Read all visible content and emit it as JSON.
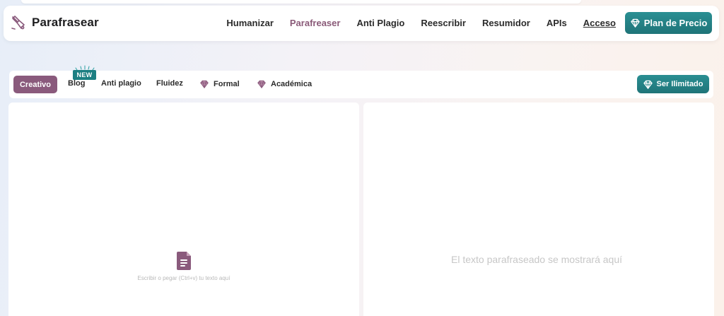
{
  "app": {
    "brand_name": "Parafrasear",
    "brand_icon": "quill-pen-icon"
  },
  "nav": {
    "items": [
      {
        "label": "Humanizar"
      },
      {
        "label": "Parafreaser",
        "active": true
      },
      {
        "label": "Anti Plagio"
      },
      {
        "label": "Reescribir"
      },
      {
        "label": "Resumidor"
      },
      {
        "label": "APIs"
      },
      {
        "label": "Acceso",
        "underline": true
      }
    ],
    "plan_button": "Plan de Precio",
    "plan_icon": "diamond-icon"
  },
  "modes": {
    "creativo": "Creativo",
    "blog": "Blog",
    "new_badge": "NEW",
    "anti_plagio": "Anti plagio",
    "fluidez": "Fluidez",
    "formal": "Formal",
    "academica": "Académica",
    "premium_icon": "diamond-icon",
    "unlimited_button": "Ser Ilimitado"
  },
  "editor": {
    "input_placeholder": "Escribir o pegar (Ctrl+v) tu texto aquí",
    "input_icon": "document-icon",
    "output_placeholder": "El texto parafraseado se mostrará aquí"
  },
  "colors": {
    "accent_purple": "#8a5a7c",
    "accent_teal": "#1f7478",
    "active_nav": "#8a5a78"
  }
}
